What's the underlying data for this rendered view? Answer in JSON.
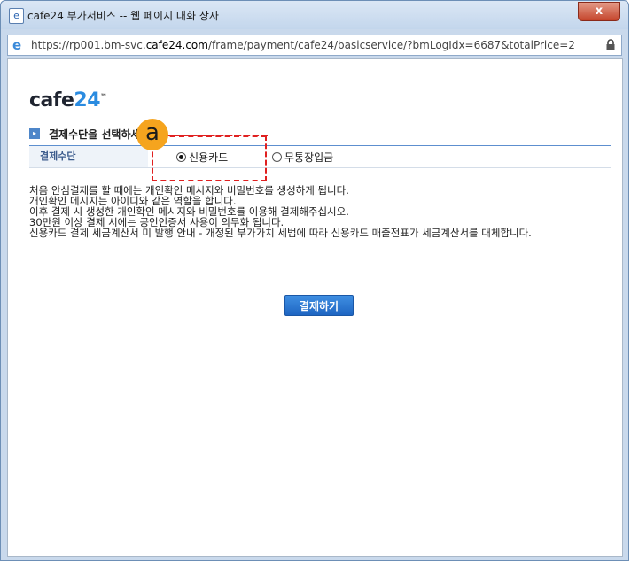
{
  "window": {
    "title": "cafe24 부가서비스 -- 웹 페이지 대화 상자",
    "close_label": "x"
  },
  "addressbar": {
    "url_prefix": "https://rp001.bm-svc.",
    "url_host": "cafe24.com",
    "url_suffix": "/frame/payment/cafe24/basicservice/?bmLogIdx=6687&totalPrice=2"
  },
  "logo": {
    "text_a": "cafe",
    "text_b": "24",
    "tm": "™"
  },
  "section": {
    "title": "결제수단을 선택하세요",
    "row_label": "결제수단",
    "options": [
      {
        "label": "신용카드",
        "selected": true
      },
      {
        "label": "무통장입금",
        "selected": false
      }
    ]
  },
  "notes": [
    "처음 안심결제를 할 때에는 개인확인 메시지와 비밀번호를 생성하게 됩니다.",
    "개인확인 메시지는 아이디와 같은 역할을 합니다.",
    "이후 결제 시 생성한 개인확인 메시지와 비밀번호를 이용해 결제해주십시오.",
    "30만원 이상 결제 시에는 공인인증서 사용이 의무화 됩니다.",
    "신용카드 결제 세금계산서 미 발행 안내 - 개정된 부가가치 세법에 따라 신용카드 매출전표가 세금계산서를 대체합니다."
  ],
  "pay_button": "결제하기",
  "annotation": {
    "badge": "a",
    "color": "#e02020"
  }
}
